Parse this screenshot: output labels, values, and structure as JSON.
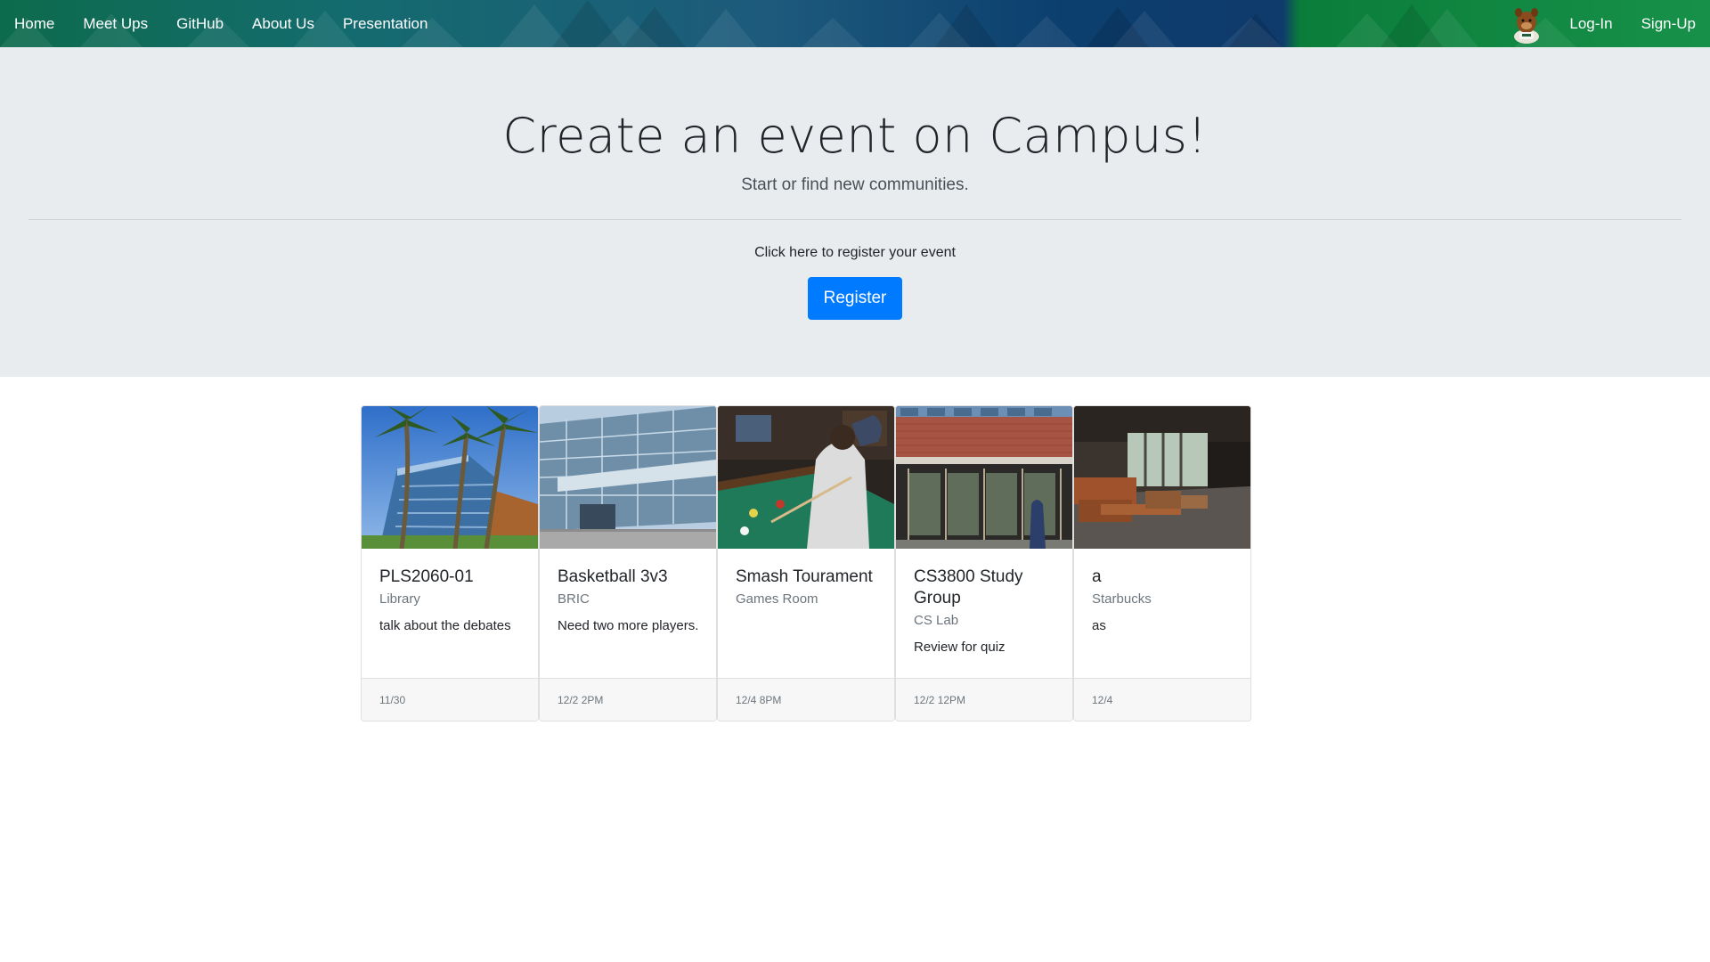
{
  "nav": {
    "left": [
      "Home",
      "Meet Ups",
      "GitHub",
      "About Us",
      "Presentation"
    ],
    "login": "Log-In",
    "signup": "Sign-Up",
    "mascot_icon": "mascot-logo-icon"
  },
  "hero": {
    "title": "Create an event on Campus!",
    "subtitle": "Start or find new communities.",
    "note": "Click here to register your event",
    "button": "Register"
  },
  "colors": {
    "primary": "#007bff",
    "jumbotron": "#e9ecef",
    "nav_blue": "#0e3a6c",
    "nav_green": "#0a7d3a"
  },
  "cards": [
    {
      "title": "PLS2060-01",
      "location": "Library",
      "text": "talk about the debates",
      "date": "11/30",
      "image": "palm-trees-building-photo"
    },
    {
      "title": "Basketball 3v3",
      "location": "BRIC",
      "text": "Need two more players.",
      "date": "12/2 2PM",
      "image": "glass-building-photo"
    },
    {
      "title": "Smash Tourament",
      "location": "Games Room",
      "text": "",
      "date": "12/4 8PM",
      "image": "pool-table-photo"
    },
    {
      "title": "CS3800 Study Group",
      "location": "CS Lab",
      "text": "Review for quiz",
      "date": "12/2 12PM",
      "image": "college-of-science-entrance-photo"
    },
    {
      "title": "a",
      "location": "Starbucks",
      "text": "as",
      "date": "12/4",
      "image": "cafe-interior-photo"
    }
  ]
}
